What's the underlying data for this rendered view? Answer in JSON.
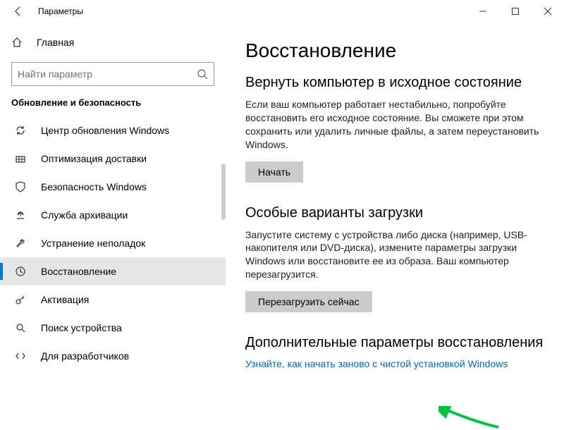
{
  "window": {
    "title": "Параметры"
  },
  "sidebar": {
    "home": "Главная",
    "search_placeholder": "Найти параметр",
    "section_title": "Обновление и безопасность",
    "items": [
      {
        "label": "Центр обновления Windows"
      },
      {
        "label": "Оптимизация доставки"
      },
      {
        "label": "Безопасность Windows"
      },
      {
        "label": "Служба архивации"
      },
      {
        "label": "Устранение неполадок"
      },
      {
        "label": "Восстановление"
      },
      {
        "label": "Активация"
      },
      {
        "label": "Поиск устройства"
      },
      {
        "label": "Для разработчиков"
      }
    ]
  },
  "main": {
    "page_title": "Восстановление",
    "reset": {
      "title": "Вернуть компьютер в исходное состояние",
      "body": "Если ваш компьютер работает нестабильно, попробуйте восстановить его исходное состояние. Вы сможете при этом сохранить или удалить личные файлы, а затем переустановить Windows.",
      "button": "Начать"
    },
    "startup": {
      "title": "Особые варианты загрузки",
      "body": "Запустите систему с устройства либо диска (например, USB-накопителя или DVD-диска), измените параметры загрузки Windows или восстановите ее из образа. Ваш компьютер перезагрузится.",
      "button": "Перезагрузить сейчас"
    },
    "more": {
      "title": "Дополнительные параметры восстановления",
      "link": "Узнайте, как начать заново с чистой установкой Windows"
    }
  }
}
